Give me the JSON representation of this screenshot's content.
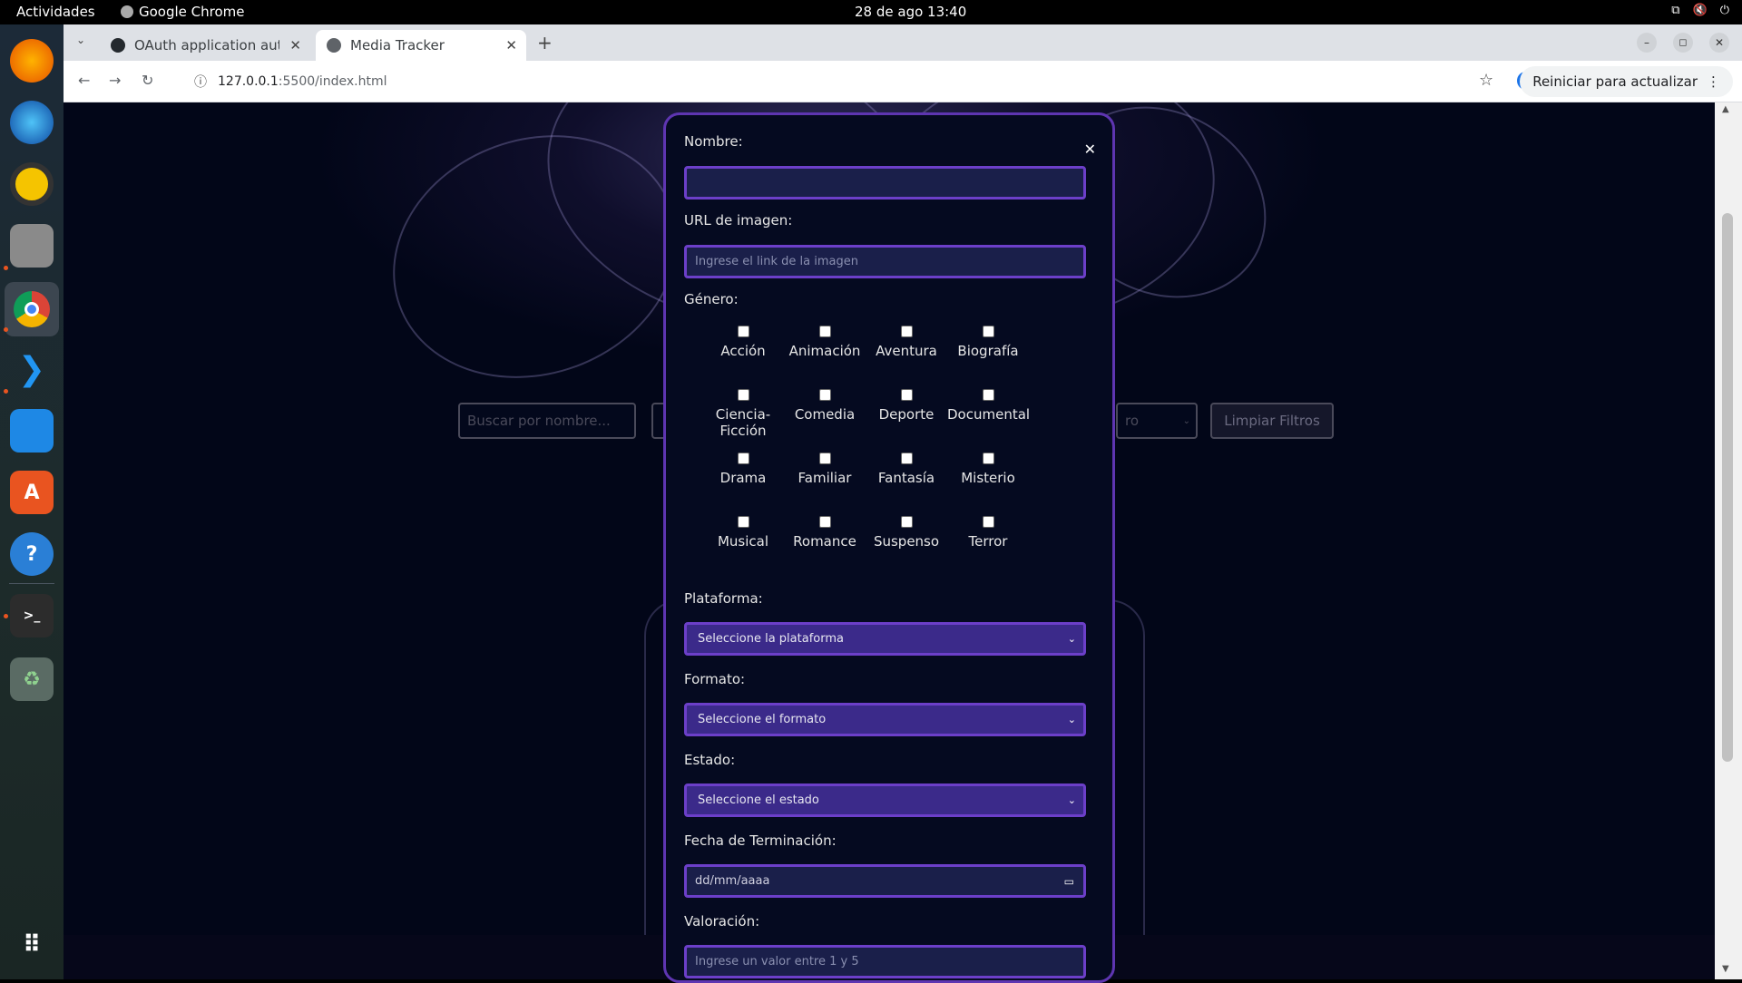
{
  "system": {
    "activities": "Actividades",
    "app_name": "Google Chrome",
    "clock": "28 de ago  13:40"
  },
  "browser": {
    "tabs": [
      {
        "label": "OAuth application autho",
        "icon": "github-icon"
      },
      {
        "label": "Media Tracker",
        "icon": "globe-icon"
      }
    ],
    "url_host": "127.0.0.1",
    "url_path": ":5500/index.html",
    "relaunch_label": "Reiniciar para actualizar"
  },
  "page": {
    "search_placeholder": "Buscar por nombre...",
    "filter_partial": "ro",
    "clear_filters": "Limpiar Filtros"
  },
  "modal": {
    "name_label": "Nombre:",
    "name_value": "",
    "image_label": "URL de imagen:",
    "image_placeholder": "Ingrese el link de la imagen",
    "genre_label": "Género:",
    "genres": [
      [
        "Acción"
      ],
      [
        "Animación"
      ],
      [
        "Aventura"
      ],
      [
        "Biografía"
      ],
      [
        "Ciencia-",
        "Ficción"
      ],
      [
        "Comedia"
      ],
      [
        "Deporte"
      ],
      [
        "Documental"
      ],
      [
        "Drama"
      ],
      [
        "Familiar"
      ],
      [
        "Fantasía"
      ],
      [
        "Misterio"
      ],
      [
        "Musical"
      ],
      [
        "Romance"
      ],
      [
        "Suspenso"
      ],
      [
        "Terror"
      ]
    ],
    "platform_label": "Plataforma:",
    "platform_value": "Seleccione la plataforma",
    "format_label": "Formato:",
    "format_value": "Seleccione el formato",
    "status_label": "Estado:",
    "status_value": "Seleccione el estado",
    "date_label": "Fecha de Terminación:",
    "date_placeholder": "dd/mm/aaaa",
    "rating_label": "Valoración:",
    "rating_placeholder": "Ingrese un valor entre 1 y 5"
  },
  "dock": [
    "firefox-icon",
    "thunderbird-icon",
    "rhythmbox-icon",
    "files-icon",
    "chrome-icon",
    "vscode-icon",
    "writer-icon",
    "app-center-icon",
    "help-icon",
    "terminal-icon",
    "trash-icon",
    "show-apps-icon"
  ]
}
